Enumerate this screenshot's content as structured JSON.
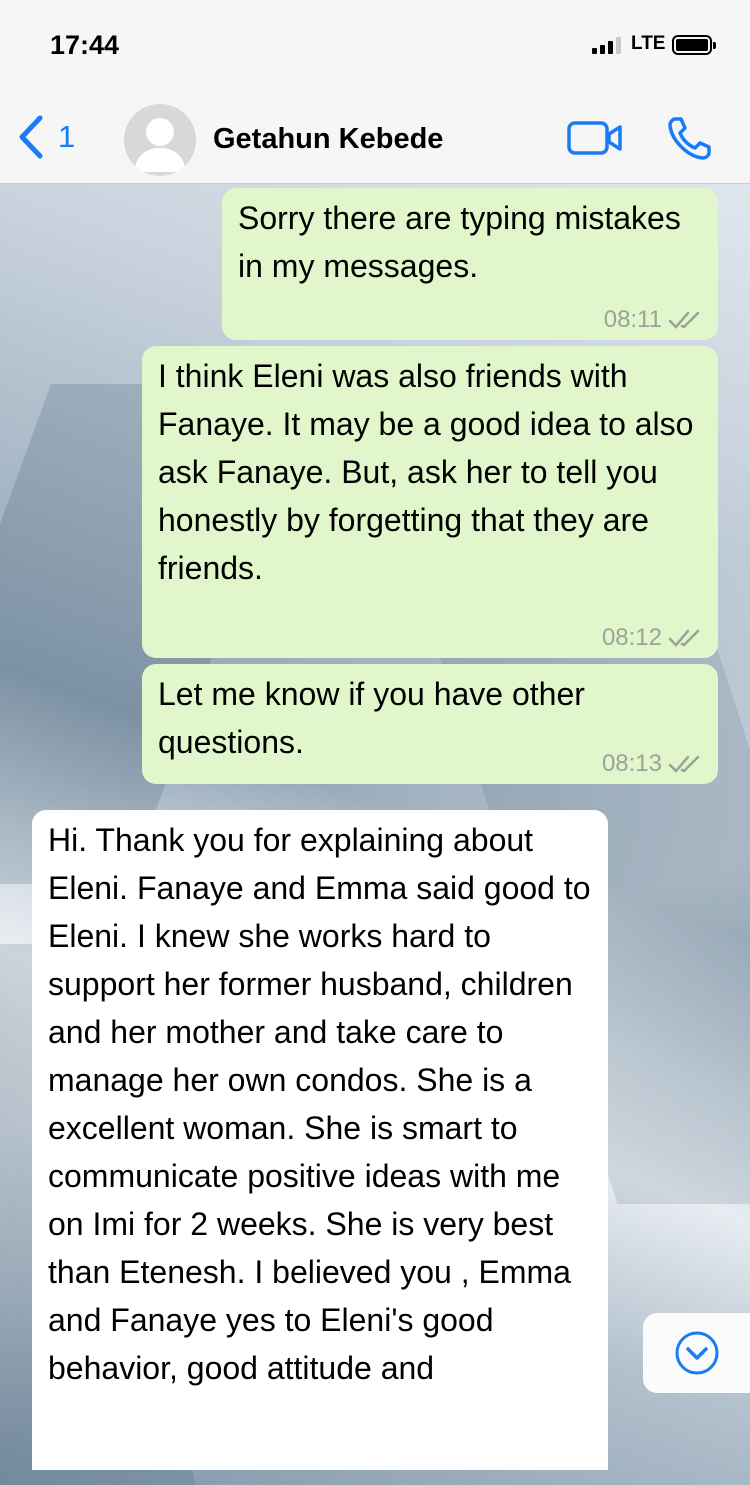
{
  "status_bar": {
    "time": "17:44",
    "network": "LTE"
  },
  "header": {
    "back_count": "1",
    "contact_name": "Getahun Kebede",
    "back_icon": "chevron-left-icon",
    "video_icon": "video-call-icon",
    "call_icon": "phone-icon"
  },
  "colors": {
    "accent": "#1a7cf5",
    "outgoing_bubble": "#e1f7cb",
    "incoming_bubble": "#ffffff"
  },
  "messages": [
    {
      "direction": "outgoing",
      "text": "Sorry there are typing mistakes in my messages.",
      "time": "08:11",
      "status": "read"
    },
    {
      "direction": "outgoing",
      "text": "I think Eleni was also friends with Fanaye. It may be a good idea to also ask Fanaye. But, ask her to tell you honestly by forgetting that they are friends.",
      "time": "08:12",
      "status": "read"
    },
    {
      "direction": "outgoing",
      "text": "Let me know if you have other questions.",
      "time": "08:13",
      "status": "read"
    },
    {
      "direction": "incoming",
      "text": "Hi. Thank you for explaining about Eleni. Fanaye and Emma said good to Eleni. I knew she works hard to support her former husband, children and her mother and take care to manage her own condos. She is a excellent woman. She is smart to communicate positive ideas with me on Imi for 2 weeks. She is very best than Etenesh. I believed you , Emma and Fanaye yes to Eleni's good behavior, good attitude and"
    }
  ]
}
